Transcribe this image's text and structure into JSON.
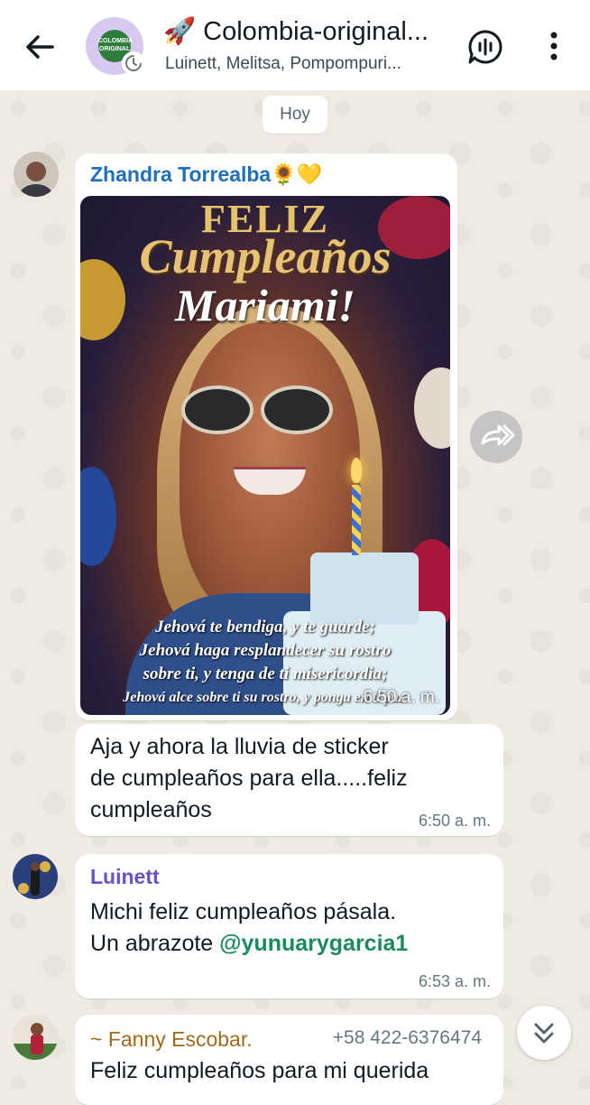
{
  "header": {
    "group_emoji": "🚀",
    "title": "Colombia-original...",
    "subtitle": "Luinett, Melitsa, Pompompuri...",
    "avatar_text": "COLOMBIA ORIGINAL"
  },
  "date_chip": "Hoy",
  "messages": [
    {
      "sender": "Zhandra Torrealba🌻💛",
      "sender_color": "#1f6fbf",
      "type": "image",
      "image": {
        "line1": "FELIZ",
        "line2": "Cumpleaños",
        "line3": "Mariami!",
        "verse": [
          "Jehová te bendiga, y te guarde;",
          "Jehová haga resplandecer su rostro",
          "sobre ti, y tenga de ti misericordia;",
          "Jehová alce sobre ti su rostro, y ponga en ti paz."
        ]
      },
      "time": "6:50 a. m."
    },
    {
      "type": "text",
      "text": "Aja y ahora la lluvia de sticker de cumpleaños para ella.....feliz cumpleaños",
      "lines": [
        "Aja y ahora la lluvia de sticker",
        "de cumpleaños para ella.....feliz",
        "cumpleaños"
      ],
      "time": "6:50 a. m."
    },
    {
      "sender": "Luinett",
      "sender_color": "#6a4fc7",
      "type": "text",
      "lines": [
        "Michi feliz cumpleaños pásala.",
        "Un abrazote "
      ],
      "mention": "@yunuarygarcia1",
      "time": "6:53 a. m."
    },
    {
      "sender": "~ Fanny Escobar.",
      "sender_color": "#a06a1c",
      "phone": "+58 422-6376474",
      "type": "text",
      "lines": [
        "Feliz cumpleaños para mi querida"
      ]
    }
  ],
  "icons": {
    "back": "arrow-left-icon",
    "voice_chat": "voice-chat-icon",
    "menu": "more-vert-icon",
    "forward": "forward-icon",
    "scroll_down": "double-chevron-down-icon",
    "disappearing": "timer-icon"
  }
}
